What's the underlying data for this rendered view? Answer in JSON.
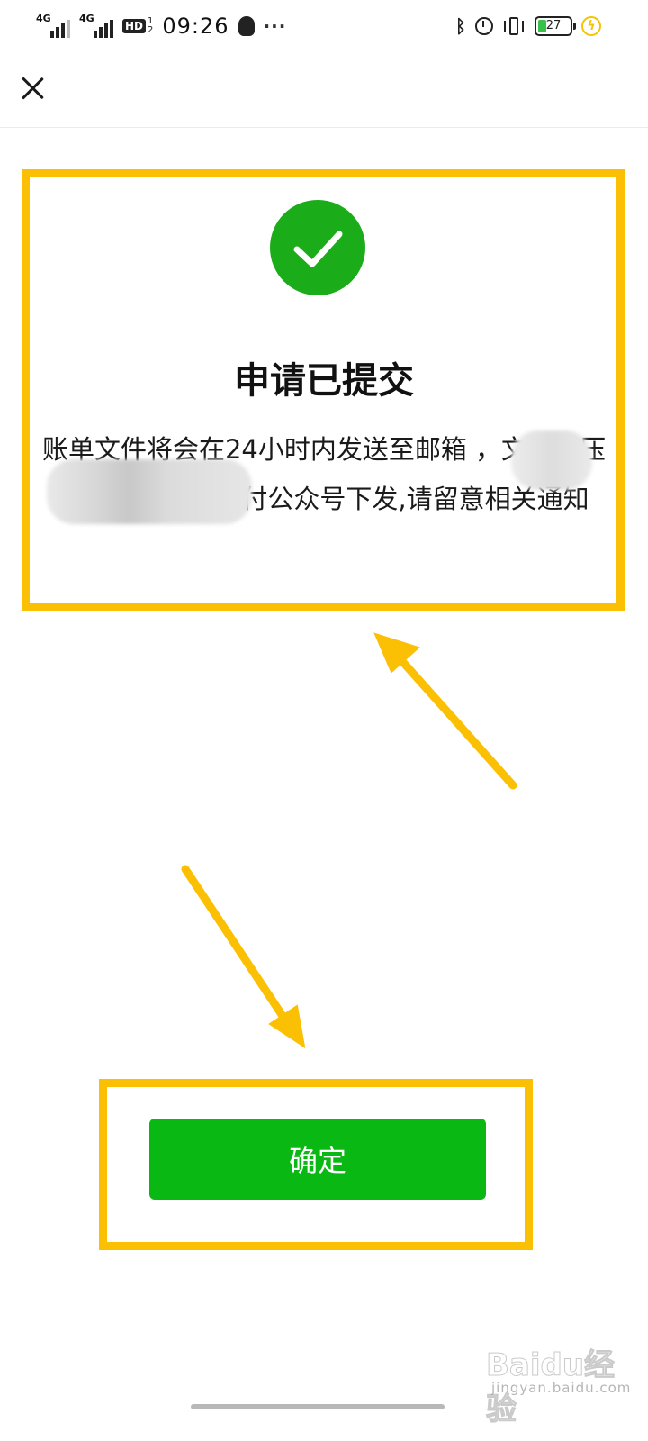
{
  "status_bar": {
    "sim1_label": "4G",
    "sim2_label": "4G",
    "hd_label": "HD",
    "hd_fraction_top": "1",
    "hd_fraction_bottom": "2",
    "time": "09:26",
    "more": "···",
    "battery_level": "27",
    "battery_fraction": 0.27,
    "icons": [
      "qq-icon",
      "bluetooth-icon",
      "alarm-icon",
      "vibrate-icon",
      "battery-icon",
      "charging-icon"
    ]
  },
  "nav": {
    "close_icon": "close-icon"
  },
  "result": {
    "icon": "success-check-icon",
    "title": "申请已提交",
    "description": "账单文件将会在24小时内发送至邮箱 ，文件解压码将通过微信支付公众号下发,请留意相关通知"
  },
  "actions": {
    "confirm_label": "确定"
  },
  "watermark": {
    "logo_text": "Baidu经验",
    "url": "jingyan.baidu.com"
  },
  "colors": {
    "success_green": "#1aad19",
    "button_green": "#09b812",
    "highlight_yellow": "#fbbf04",
    "text": "#111111"
  }
}
